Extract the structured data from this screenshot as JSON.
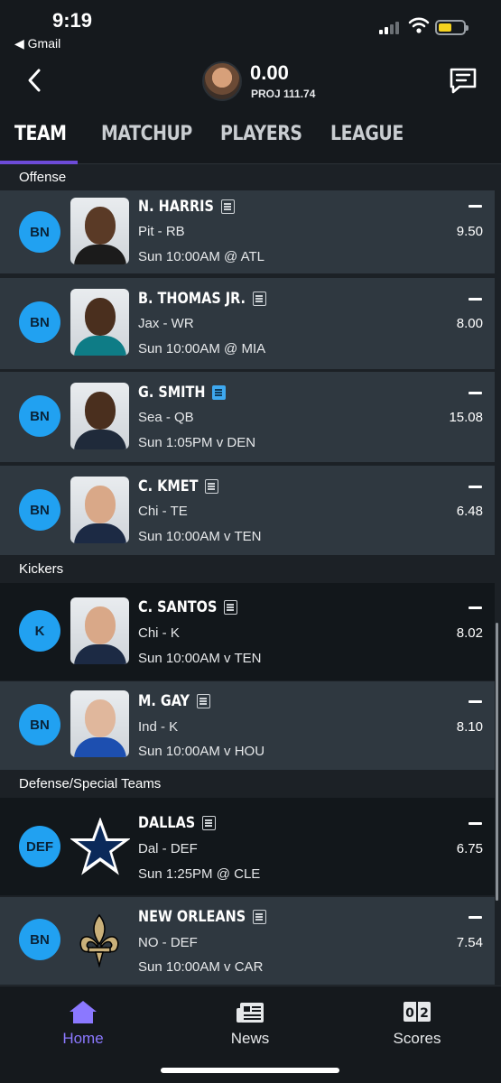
{
  "status_bar": {
    "time": "9:19",
    "back_app": "◀ Gmail"
  },
  "header": {
    "score": "0.00",
    "proj": "PROJ 111.74"
  },
  "tabs": [
    {
      "label": "TEAM"
    },
    {
      "label": "MATCHUP"
    },
    {
      "label": "PLAYERS"
    },
    {
      "label": "LEAGUE"
    }
  ],
  "sections": {
    "offense": "Offense",
    "kickers": "Kickers",
    "defense": "Defense/Special Teams"
  },
  "players": [
    {
      "slot": "BN",
      "name": "N. HARRIS",
      "pos": "Pit - RB",
      "game": "Sun 10:00AM @ ATL",
      "score": "–",
      "proj": "9.50"
    },
    {
      "slot": "BN",
      "name": "B. THOMAS JR.",
      "pos": "Jax - WR",
      "game": "Sun 10:00AM @ MIA",
      "score": "–",
      "proj": "8.00"
    },
    {
      "slot": "BN",
      "name": "G. SMITH",
      "pos": "Sea - QB",
      "game": "Sun 1:05PM v DEN",
      "score": "–",
      "proj": "15.08"
    },
    {
      "slot": "BN",
      "name": "C. KMET",
      "pos": "Chi - TE",
      "game": "Sun 10:00AM v TEN",
      "score": "–",
      "proj": "6.48"
    },
    {
      "slot": "K",
      "name": "C. SANTOS",
      "pos": "Chi - K",
      "game": "Sun 10:00AM v TEN",
      "score": "–",
      "proj": "8.02"
    },
    {
      "slot": "BN",
      "name": "M. GAY",
      "pos": "Ind - K",
      "game": "Sun 10:00AM v HOU",
      "score": "–",
      "proj": "8.10"
    },
    {
      "slot": "DEF",
      "name": "DALLAS",
      "pos": "Dal - DEF",
      "game": "Sun 1:25PM @ CLE",
      "score": "–",
      "proj": "6.75"
    },
    {
      "slot": "BN",
      "name": "NEW ORLEANS",
      "pos": "NO - DEF",
      "game": "Sun 10:00AM v CAR",
      "score": "–",
      "proj": "7.54"
    }
  ],
  "bottom_nav": [
    {
      "label": "Home",
      "icon": "home-icon"
    },
    {
      "label": "News",
      "icon": "news-icon"
    },
    {
      "label": "Scores",
      "icon": "scores-icon"
    }
  ],
  "colors": {
    "accent": "#6d4bd8",
    "slot_badge": "#21a1f1",
    "nav_active": "#8b78ff"
  }
}
